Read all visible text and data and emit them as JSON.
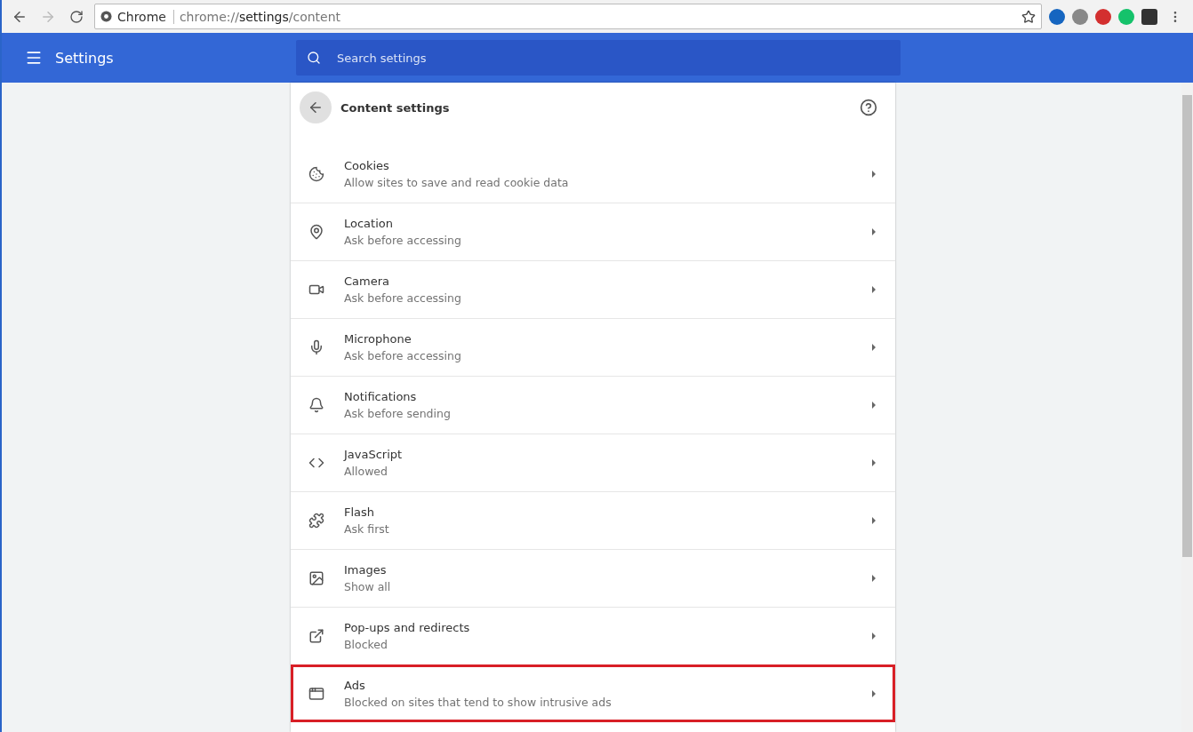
{
  "browser": {
    "site_label": "Chrome",
    "url": {
      "scheme": "chrome://",
      "host": "settings",
      "path": "/content"
    }
  },
  "header": {
    "title": "Settings",
    "search": {
      "placeholder": "Search settings"
    }
  },
  "page": {
    "title": "Content settings",
    "items": [
      {
        "label": "Cookies",
        "description": "Allow sites to save and read cookie data",
        "highlighted": false
      },
      {
        "label": "Location",
        "description": "Ask before accessing",
        "highlighted": false
      },
      {
        "label": "Camera",
        "description": "Ask before accessing",
        "highlighted": false
      },
      {
        "label": "Microphone",
        "description": "Ask before accessing",
        "highlighted": false
      },
      {
        "label": "Notifications",
        "description": "Ask before sending",
        "highlighted": false
      },
      {
        "label": "JavaScript",
        "description": "Allowed",
        "highlighted": false
      },
      {
        "label": "Flash",
        "description": "Ask first",
        "highlighted": false
      },
      {
        "label": "Images",
        "description": "Show all",
        "highlighted": false
      },
      {
        "label": "Pop-ups and redirects",
        "description": "Blocked",
        "highlighted": false
      },
      {
        "label": "Ads",
        "description": "Blocked on sites that tend to show intrusive ads",
        "highlighted": true
      }
    ]
  }
}
